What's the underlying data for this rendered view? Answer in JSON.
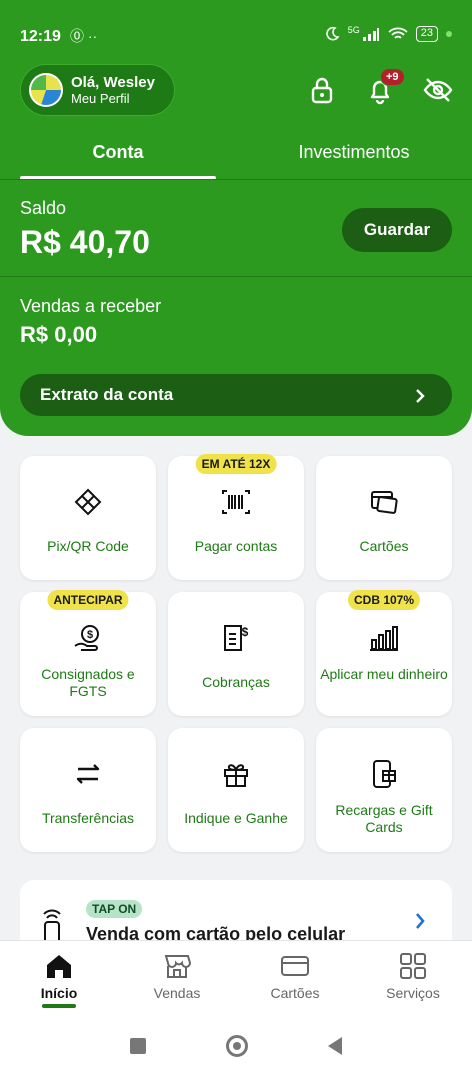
{
  "status_bar": {
    "time": "12:19",
    "battery": "23",
    "app_icons": "⓪ ··",
    "network": "5G"
  },
  "header": {
    "greeting": "Olá, Wesley",
    "profile_link": "Meu Perfil",
    "notification_count": "+9"
  },
  "tabs": [
    {
      "label": "Conta",
      "active": true
    },
    {
      "label": "Investimentos",
      "active": false
    }
  ],
  "balance": {
    "label": "Saldo",
    "value": "R$ 40,70",
    "save_button": "Guardar"
  },
  "receivables": {
    "label": "Vendas a receber",
    "value": "R$ 0,00"
  },
  "statement_button": "Extrato da conta",
  "tiles": [
    {
      "label": "Pix/QR Code",
      "icon": "pix-icon",
      "badge": ""
    },
    {
      "label": "Pagar contas",
      "icon": "barcode-icon",
      "badge": "EM ATÉ 12X"
    },
    {
      "label": "Cartões",
      "icon": "cards-icon",
      "badge": ""
    },
    {
      "label": "Consignados e FGTS",
      "icon": "money-hand-icon",
      "badge": "ANTECIPAR"
    },
    {
      "label": "Cobranças",
      "icon": "invoice-icon",
      "badge": ""
    },
    {
      "label": "Aplicar meu dinheiro",
      "icon": "chart-money-icon",
      "badge": "CDB 107%"
    },
    {
      "label": "Transferências",
      "icon": "transfer-icon",
      "badge": ""
    },
    {
      "label": "Indique e Ganhe",
      "icon": "gift-icon",
      "badge": ""
    },
    {
      "label": "Recargas e Gift Cards",
      "icon": "phone-gift-icon",
      "badge": ""
    }
  ],
  "tap_card": {
    "badge": "TAP ON",
    "title": "Venda com cartão pelo celular"
  },
  "bottom_nav": [
    {
      "label": "Início",
      "icon": "home-icon",
      "active": true
    },
    {
      "label": "Vendas",
      "icon": "store-icon",
      "active": false
    },
    {
      "label": "Cartões",
      "icon": "card-icon",
      "active": false
    },
    {
      "label": "Serviços",
      "icon": "grid-icon",
      "active": false
    }
  ],
  "colors": {
    "brand_green": "#2b9a1e",
    "dark_green": "#1b5e14",
    "badge_yellow": "#efe24a",
    "text_green": "#1e7a15"
  }
}
